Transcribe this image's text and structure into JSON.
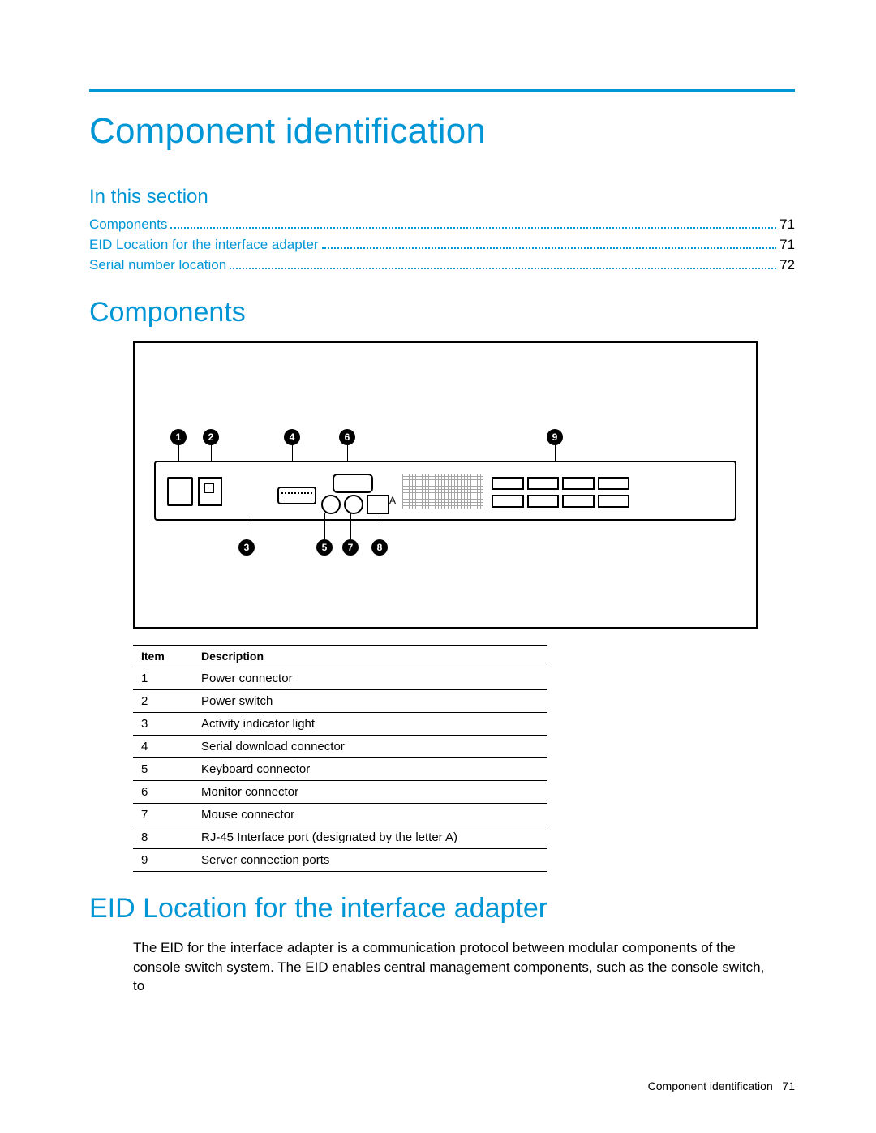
{
  "title": "Component identification",
  "in_this_section_label": "In this section",
  "toc": [
    {
      "label": "Components",
      "page": "71"
    },
    {
      "label": "EID Location for the interface adapter",
      "page": "71"
    },
    {
      "label": "Serial number location",
      "page": "72"
    }
  ],
  "section_components": "Components",
  "callouts": {
    "top": [
      "1",
      "2",
      "4",
      "6",
      "9"
    ],
    "bottom": [
      "3",
      "5",
      "7",
      "8"
    ],
    "port_label": "A"
  },
  "table": {
    "headers": [
      "Item",
      "Description"
    ],
    "rows": [
      [
        "1",
        "Power connector"
      ],
      [
        "2",
        "Power switch"
      ],
      [
        "3",
        "Activity indicator light"
      ],
      [
        "4",
        "Serial download connector"
      ],
      [
        "5",
        "Keyboard connector"
      ],
      [
        "6",
        "Monitor connector"
      ],
      [
        "7",
        "Mouse connector"
      ],
      [
        "8",
        "RJ-45 Interface port (designated by the letter A)"
      ],
      [
        "9",
        "Server connection ports"
      ]
    ]
  },
  "section_eid": "EID Location for the interface adapter",
  "eid_paragraph": "The EID for the interface adapter is a communication protocol between modular components of the console switch system. The EID enables central management components, such as the console switch, to",
  "footer": {
    "label": "Component identification",
    "page": "71"
  }
}
